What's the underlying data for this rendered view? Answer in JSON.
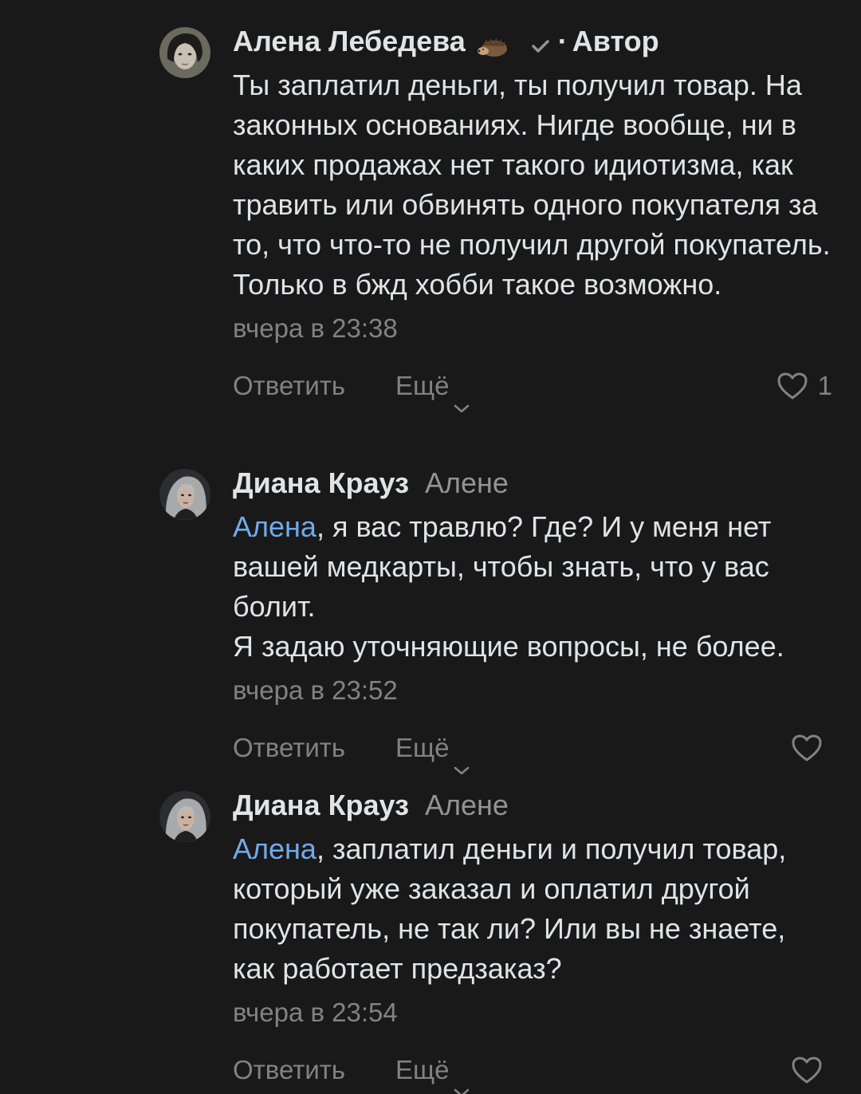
{
  "comments": [
    {
      "author": "Алена Лебедева",
      "author_emoji": "hedgehog-icon",
      "verified_icon": "check-icon",
      "separator": "·",
      "badge": "Автор",
      "reply_to": "",
      "mention": "",
      "mention_suffix": "",
      "text": "Ты заплатил деньги, ты получил товар. На законных основаниях. Нигде вообще, ни в каких продажах нет такого идиотизма, как травить или обвинять одного покупателя за то, что что-то не получил другой покупатель. Только в бжд хобби такое возможно.",
      "time": "вчера в 23:38",
      "reply_label": "Ответить",
      "more_label": "Ещё",
      "likes": "1"
    },
    {
      "author": "Диана Крауз",
      "reply_to": "Алене",
      "mention": "Алена",
      "mention_suffix": ", я вас травлю? Где? И у меня нет вашей медкарты, чтобы знать, что у вас болит.\nЯ задаю уточняющие вопросы, не более.",
      "time": "вчера в 23:52",
      "reply_label": "Ответить",
      "more_label": "Ещё",
      "likes": ""
    },
    {
      "author": "Диана Крауз",
      "reply_to": "Алене",
      "mention": "Алена",
      "mention_suffix": ", заплатил деньги и получил товар, который уже заказал и оплатил другой покупатель, не так ли? Или вы не знаете, как работает предзаказ?",
      "time": "вчера в 23:54",
      "reply_label": "Ответить",
      "more_label": "Ещё",
      "likes": ""
    }
  ],
  "colors": {
    "background": "#19191a",
    "text": "#e1e3e6",
    "secondary": "#828282",
    "mention": "#71aaeb"
  }
}
